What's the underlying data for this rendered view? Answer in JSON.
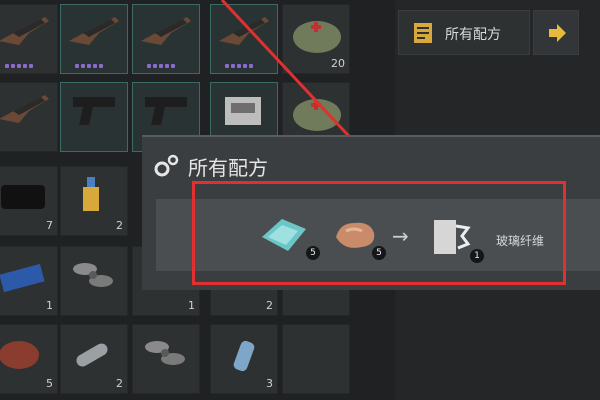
{
  "inventory": {
    "slots": [
      {
        "col": 0,
        "row": 0,
        "icon": "rifle-icon",
        "rarity_dots": 5,
        "count": ""
      },
      {
        "col": 1,
        "row": 0,
        "icon": "rifle-icon",
        "rarity_dots": 5,
        "count": ""
      },
      {
        "col": 2,
        "row": 0,
        "icon": "rifle-icon",
        "rarity_dots": 5,
        "count": ""
      },
      {
        "col": 3,
        "row": 0,
        "icon": "rifle-icon",
        "rarity_dots": 5,
        "count": ""
      },
      {
        "col": 4,
        "row": 0,
        "icon": "medkit-bag-icon",
        "rarity_dots": 0,
        "count": "20"
      },
      {
        "col": 0,
        "row": 1,
        "icon": "rifle-icon",
        "rarity_dots": 0,
        "count": ""
      },
      {
        "col": 1,
        "row": 1,
        "icon": "pistol-icon",
        "rarity_dots": 0,
        "count": ""
      },
      {
        "col": 2,
        "row": 1,
        "icon": "pistol-icon",
        "rarity_dots": 0,
        "count": ""
      },
      {
        "col": 3,
        "row": 1,
        "icon": "engine-part-icon",
        "rarity_dots": 0,
        "count": ""
      },
      {
        "col": 4,
        "row": 1,
        "icon": "medkit-bag-icon",
        "rarity_dots": 0,
        "count": ""
      },
      {
        "col": 0,
        "row": 2,
        "icon": "cloth-icon",
        "rarity_dots": 0,
        "count": "7"
      },
      {
        "col": 1,
        "row": 2,
        "icon": "glue-icon",
        "rarity_dots": 0,
        "count": "2"
      },
      {
        "col": 0,
        "row": 3,
        "icon": "circuit-board-icon",
        "rarity_dots": 0,
        "count": "1"
      },
      {
        "col": 1,
        "row": 3,
        "icon": "propeller-icon",
        "rarity_dots": 0,
        "count": ""
      },
      {
        "col": 2,
        "row": 3,
        "icon": "item-icon",
        "rarity_dots": 0,
        "count": "1"
      },
      {
        "col": 3,
        "row": 3,
        "icon": "item-icon",
        "rarity_dots": 0,
        "count": "2"
      },
      {
        "col": 4,
        "row": 3,
        "icon": "item-icon",
        "rarity_dots": 0,
        "count": ""
      },
      {
        "col": 0,
        "row": 4,
        "icon": "meat-icon",
        "rarity_dots": 0,
        "count": "5"
      },
      {
        "col": 1,
        "row": 4,
        "icon": "bottle-icon",
        "rarity_dots": 0,
        "count": "2"
      },
      {
        "col": 2,
        "row": 4,
        "icon": "propeller-icon",
        "rarity_dots": 0,
        "count": ""
      },
      {
        "col": 3,
        "row": 4,
        "icon": "water-bottle-icon",
        "rarity_dots": 0,
        "count": "3"
      },
      {
        "col": 4,
        "row": 4,
        "icon": "empty",
        "rarity_dots": 0,
        "count": ""
      }
    ]
  },
  "right_panel": {
    "recipes_button_label": "所有配方",
    "recipes_button_icon": "recipe-book-icon",
    "arrow_icon": "arrow-right-icon"
  },
  "popup": {
    "title": "所有配方",
    "title_icon": "gears-icon",
    "recipe": {
      "inputs": [
        {
          "icon": "glass-shards-icon",
          "count": "5"
        },
        {
          "icon": "rock-ore-icon",
          "count": "5"
        }
      ],
      "arrow": "→",
      "output": {
        "icon": "fiberglass-icon",
        "count": "1",
        "label": "玻璃纤维"
      }
    }
  },
  "colors": {
    "highlight": "#e03030",
    "rarity": "#8a6acd",
    "accent": "#e8b93a"
  }
}
